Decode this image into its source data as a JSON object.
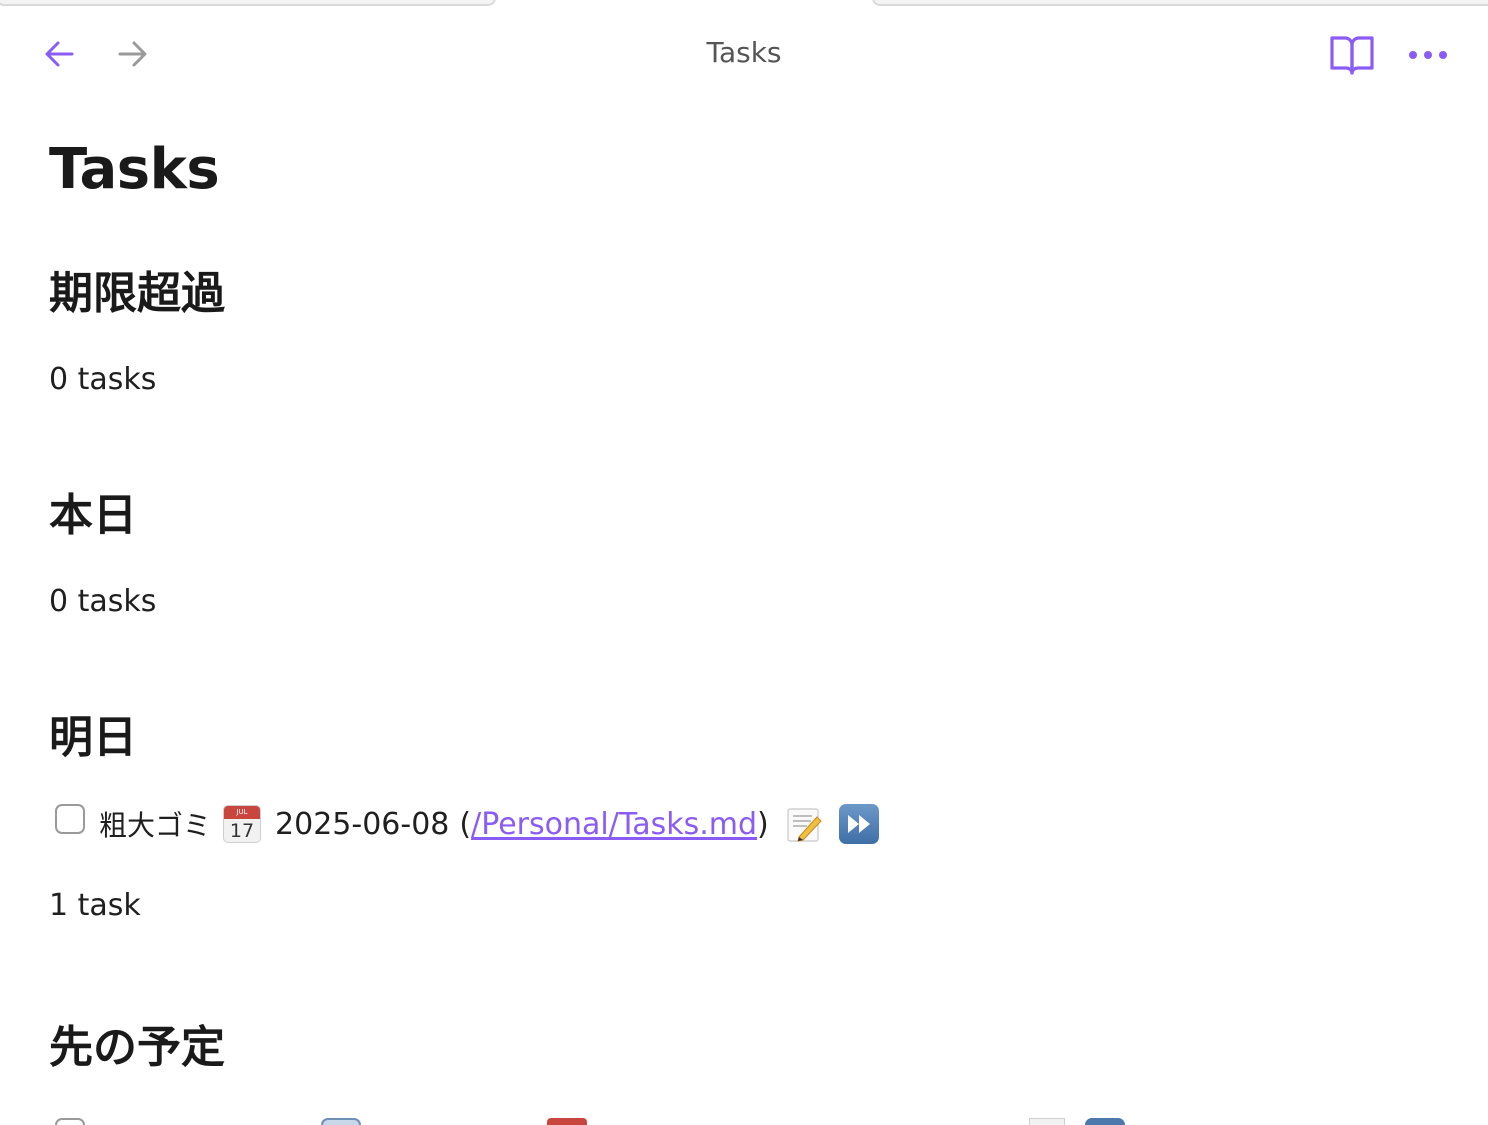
{
  "header": {
    "title": "Tasks"
  },
  "page": {
    "title": "Tasks"
  },
  "sections": [
    {
      "heading": "期限超過",
      "count": "0 tasks"
    },
    {
      "heading": "本日",
      "count": "0 tasks"
    },
    {
      "heading": "明日",
      "count": "1 task",
      "task": {
        "description": "粗大ゴミ",
        "date": "2025-06-08",
        "paren_open": "(",
        "file_link": "/Personal/Tasks.md",
        "paren_close": ")"
      }
    },
    {
      "heading": "先の予定"
    }
  ],
  "icons": {
    "back": "arrow-left-icon",
    "forward": "arrow-right-icon",
    "reading_view": "book-open-icon",
    "more": "more-horizontal-icon",
    "calendar": "calendar-icon",
    "memo": "memo-icon",
    "fast_forward": "fast-forward-icon"
  },
  "colors": {
    "accent": "#8a5cf5",
    "nav_disabled": "#9a9a9a",
    "text": "#1f1f1f"
  }
}
